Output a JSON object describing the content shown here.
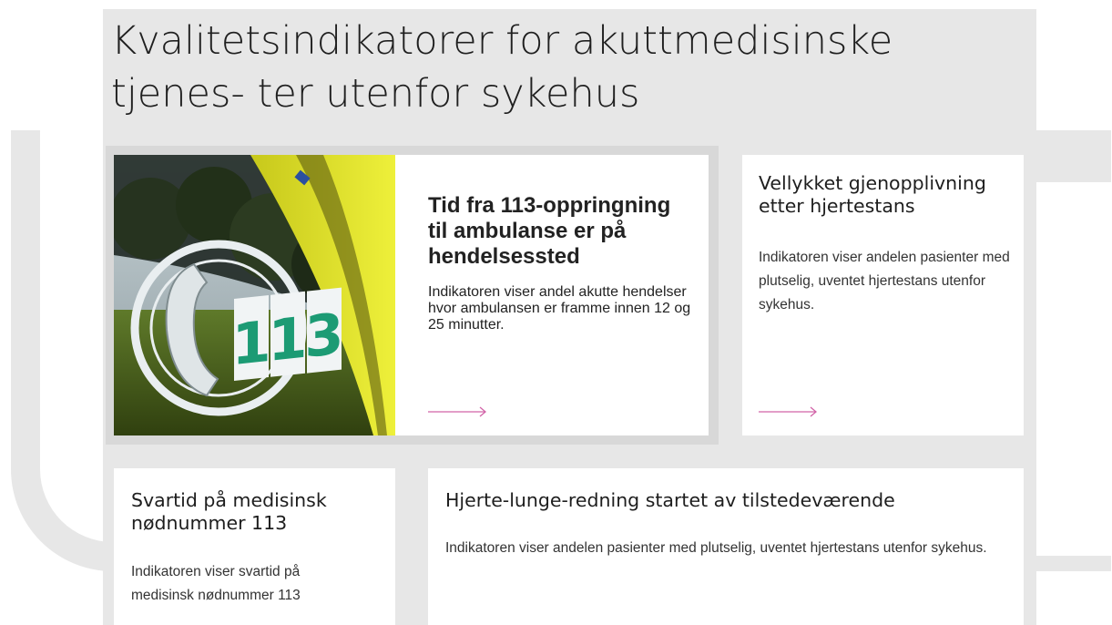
{
  "page": {
    "title": "Kvalitetsindikatorer for akuttmedisinske tjenes- ter utenfor sykehus"
  },
  "cards": [
    {
      "title": "Tid fra 113-oppringning til ambulanse er på hendelsessted",
      "text": "Indikatoren viser andel akutte hendelser hvor ambulansen er framme innen 12 og 25 minutter.",
      "image_text": "113"
    },
    {
      "title": "Vellykket gjenopplivning etter hjertestans",
      "text": "Indikatoren viser andelen pasienter med plutselig, uventet hjertestans utenfor sykehus."
    },
    {
      "title": "Svartid på medisinsk nødnummer 113",
      "text": "Indikatoren viser svartid på medisinsk nødnummer 113"
    },
    {
      "title": "Hjerte-lunge-redning startet av tilstedeværende",
      "text": "Indikatoren viser andelen pasienter med plutselig, uventet hjertestans utenfor sykehus."
    }
  ],
  "colors": {
    "accent": "#d264a8",
    "panel": "#e7e7e7"
  },
  "icons": {
    "arrow": "arrow-right-icon"
  }
}
